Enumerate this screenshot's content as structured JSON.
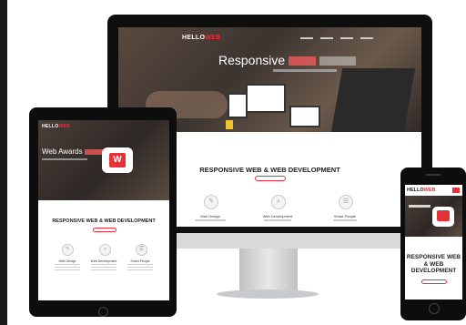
{
  "colors": {
    "accent": "#e53238",
    "dark": "#0e0e0e"
  },
  "logo": {
    "main": "HELLO",
    "accent": "WEB"
  },
  "desktop": {
    "nav": [
      "",
      "",
      "",
      ""
    ],
    "hero_title": "Responsive",
    "section_title": "RESPONSIVE WEB & WEB DEVELOPMENT",
    "section_button": "",
    "features": [
      {
        "title": "Web Design",
        "icon": "design-icon"
      },
      {
        "title": "Web Development",
        "icon": "search-icon"
      },
      {
        "title": "Smart People",
        "icon": "people-icon"
      }
    ]
  },
  "tablet": {
    "hero_title": "Web Awards",
    "section_title": "RESPONSIVE WEB & WEB DEVELOPMENT",
    "features": [
      {
        "title": "Web Design",
        "icon": "design-icon"
      },
      {
        "title": "Web Development",
        "icon": "search-icon"
      },
      {
        "title": "Smart People",
        "icon": "people-icon"
      }
    ]
  },
  "phone": {
    "section_title_1": "RESPONSIVE WEB",
    "section_title_2": "& WEB",
    "section_title_3": "DEVELOPMENT"
  }
}
